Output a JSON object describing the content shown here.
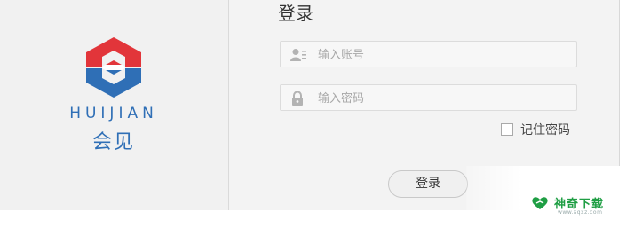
{
  "brand": {
    "name_en": "HUIJIAN",
    "name_cn": "会见",
    "colors": {
      "red": "#e2353a",
      "blue": "#2f6fb6"
    }
  },
  "login": {
    "title": "登录",
    "account_placeholder": "输入账号",
    "password_placeholder": "输入密码",
    "remember_label": "记住密码",
    "remember_checked": false,
    "submit_label": "登录"
  },
  "watermark": {
    "text": "神奇下载",
    "url": "www.sqxz.com",
    "color": "#1f9e44"
  },
  "icons": {
    "account": "user-card-icon",
    "password": "lock-icon",
    "logo": "huijian-hexagon-logo",
    "watermark": "heart-leaf-icon"
  }
}
